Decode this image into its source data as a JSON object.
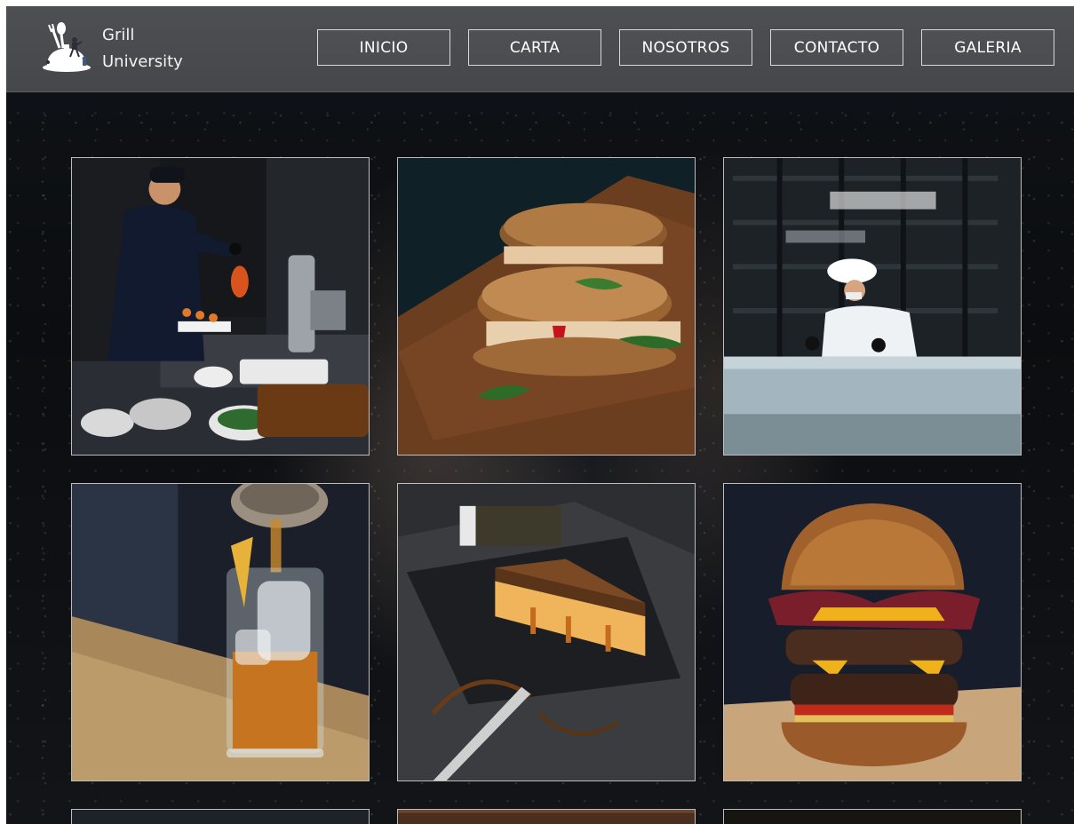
{
  "brand": {
    "name_line1": "Grill",
    "name_line2": "University",
    "logo_icon": "chef-logo-icon"
  },
  "nav": {
    "items": [
      {
        "label": "INICIO"
      },
      {
        "label": "CARTA"
      },
      {
        "label": "NOSOTROS"
      },
      {
        "label": "CONTACTO"
      },
      {
        "label": "GALERIA"
      }
    ]
  },
  "gallery": {
    "images": [
      {
        "subject": "chef-pouring-sauce-photo"
      },
      {
        "subject": "sandwich-on-board-photo"
      },
      {
        "subject": "chef-in-kitchen-photo"
      },
      {
        "subject": "whisky-cocktail-photo"
      },
      {
        "subject": "cheesecake-slice-photo"
      },
      {
        "subject": "double-burger-photo"
      },
      {
        "subject": "gallery-photo-7"
      },
      {
        "subject": "gallery-photo-8"
      },
      {
        "subject": "gallery-photo-9"
      }
    ]
  },
  "colors": {
    "header_bg": "#4d4f52",
    "page_bg": "#0c0e11",
    "nav_border": "#d8d8d8",
    "nav_text": "#ffffff"
  }
}
